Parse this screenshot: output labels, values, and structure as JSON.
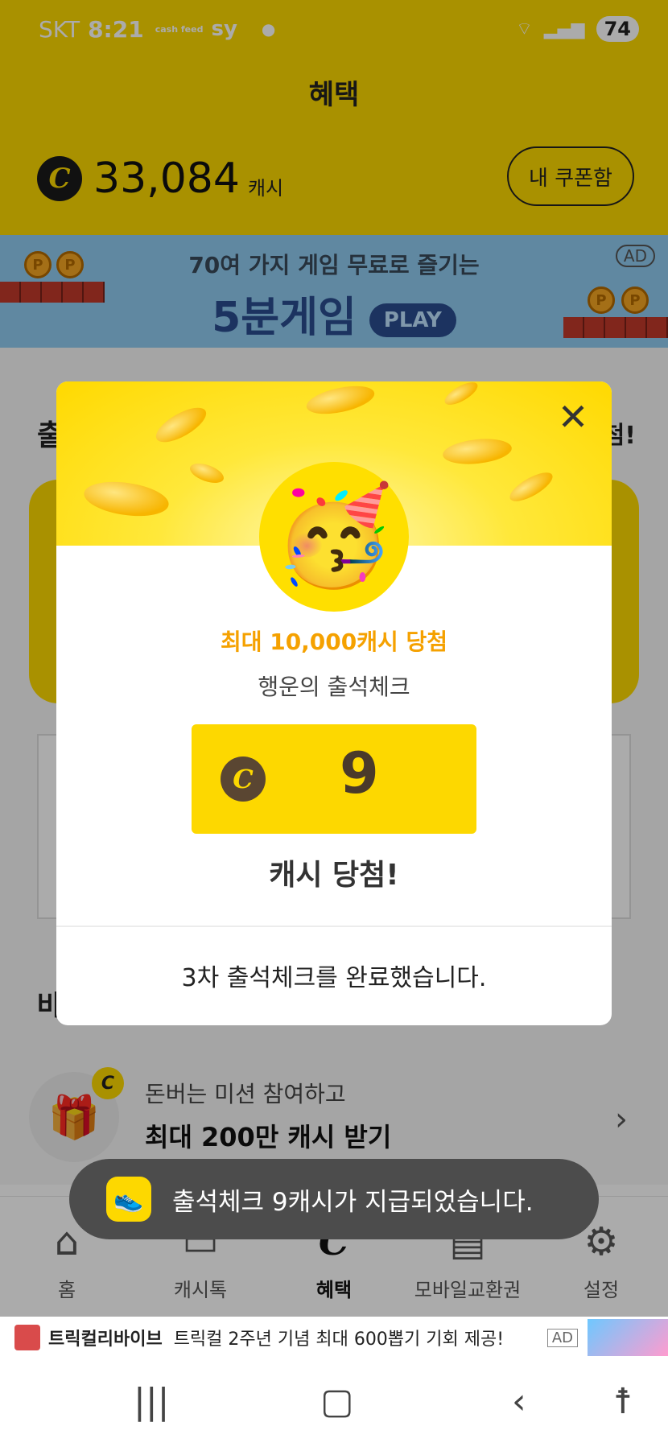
{
  "status_bar": {
    "carrier": "SKT",
    "time": "8:21",
    "app_badge": "cash feed",
    "sy": "sy",
    "battery": "74"
  },
  "header": {
    "title": "혜택",
    "cash_amount": "33,084",
    "cash_unit": "캐시",
    "coupon_button": "내 쿠폰함"
  },
  "banner": {
    "line1": "70여 가지 게임 무료로 즐기는",
    "line2": "5분게임",
    "play": "PLAY",
    "ad": "AD"
  },
  "content": {
    "attendance_title": "출",
    "attendance_right": "첨!",
    "section_title": "바",
    "mission_sub": "돈버는 미션 참여하고",
    "mission_main": "최대 200만 캐시 받기"
  },
  "dialog": {
    "prize": "최대 10,000캐시 당첨",
    "subtitle": "행운의 출석체크",
    "amount": "9",
    "won": "캐시 당첨!",
    "done": "3차 출석체크를 완료했습니다."
  },
  "toast": {
    "message": "출석체크 9캐시가 지급되었습니다."
  },
  "bottom_nav": {
    "items": [
      {
        "label": "홈",
        "icon": "home-icon"
      },
      {
        "label": "캐시톡",
        "icon": "talk-icon"
      },
      {
        "label": "혜택",
        "icon": "benefit-icon"
      },
      {
        "label": "모바일교환권",
        "icon": "ticket-icon"
      },
      {
        "label": "설정",
        "icon": "gear-icon"
      }
    ]
  },
  "ad_bar": {
    "brand": "트릭컬리바이브",
    "text": "트릭컬 2주년 기념 최대 600뽑기 기회 제공!",
    "tag": "AD"
  },
  "colors": {
    "brand_yellow": "#fdd800",
    "prize_orange": "#f5a100"
  }
}
